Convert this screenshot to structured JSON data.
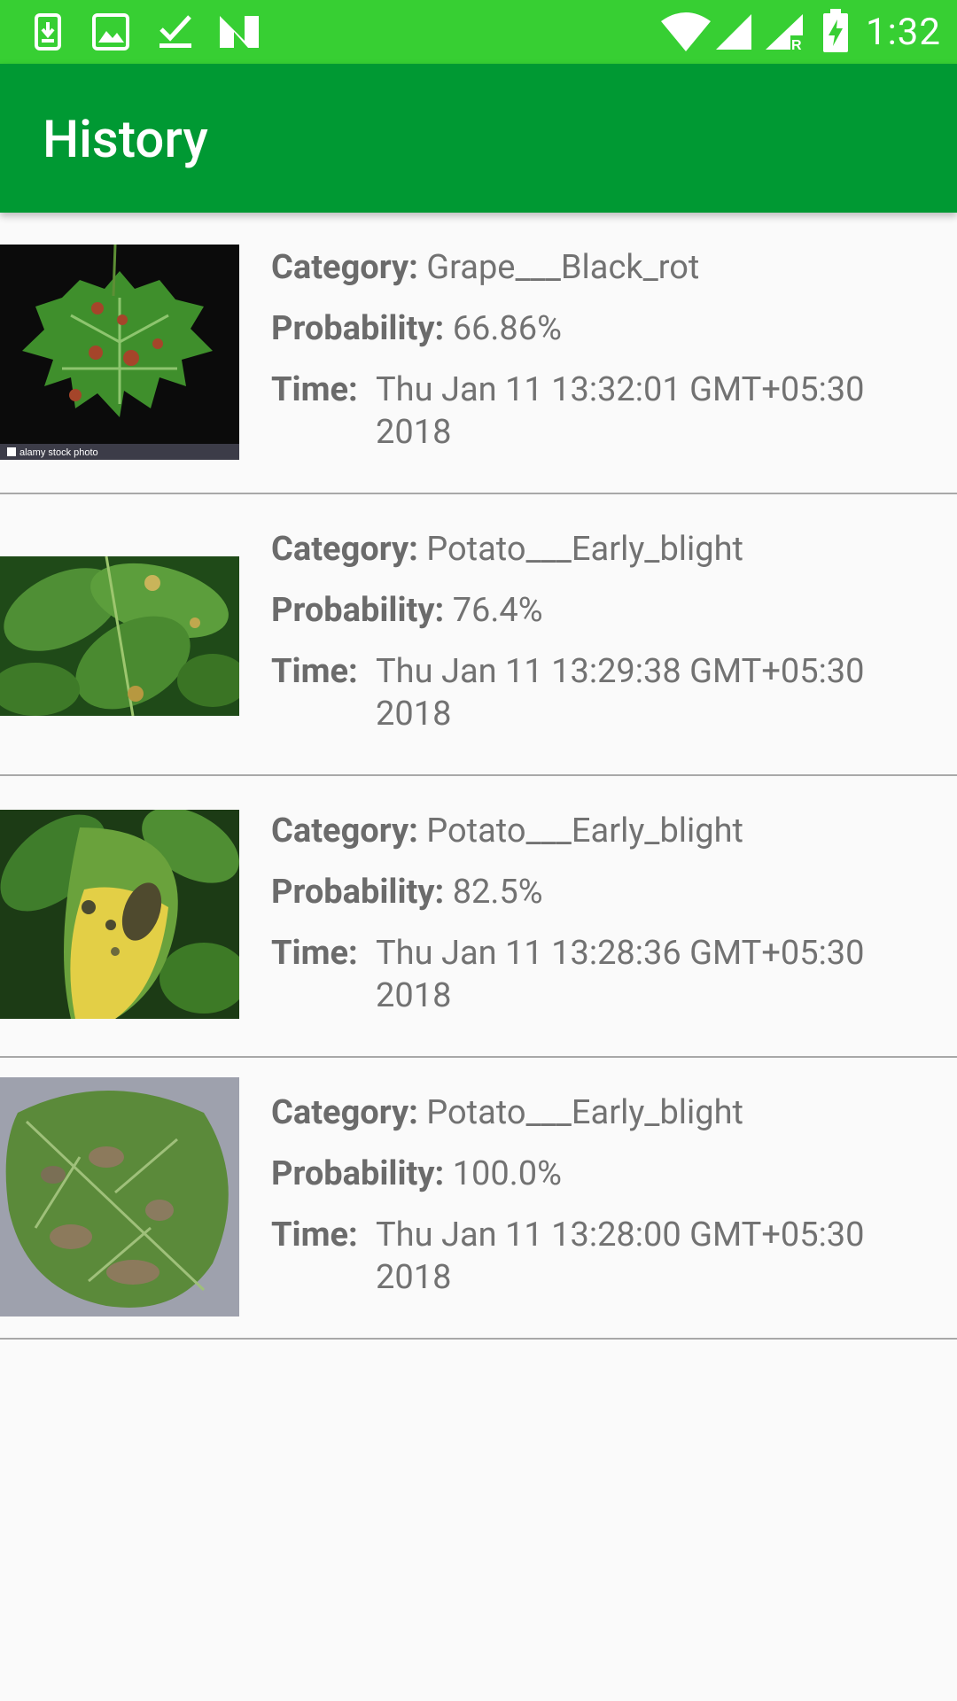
{
  "status_bar": {
    "time": "1:32",
    "left_icons": [
      "download-icon",
      "image-icon",
      "check-icon",
      "n-icon"
    ],
    "right_icons": [
      "wifi-icon",
      "signal-icon",
      "signal-roaming-icon",
      "battery-charging-icon"
    ],
    "roaming_letter": "R",
    "color": "#37cf33"
  },
  "app_bar": {
    "title": "History",
    "color": "#009933"
  },
  "labels": {
    "category": "Category:",
    "probability": "Probability:",
    "time": "Time:"
  },
  "history": [
    {
      "category": "Grape___Black_rot",
      "probability": "66.86%",
      "time": "Thu Jan 11 13:32:01 GMT+05:30 2018",
      "watermark": "alamy stock photo"
    },
    {
      "category": "Potato___Early_blight",
      "probability": "76.4%",
      "time": "Thu Jan 11 13:29:38 GMT+05:30 2018"
    },
    {
      "category": "Potato___Early_blight",
      "probability": "82.5%",
      "time": "Thu Jan 11 13:28:36 GMT+05:30 2018"
    },
    {
      "category": "Potato___Early_blight",
      "probability": "100.0%",
      "time": "Thu Jan 11 13:28:00 GMT+05:30 2018"
    }
  ]
}
